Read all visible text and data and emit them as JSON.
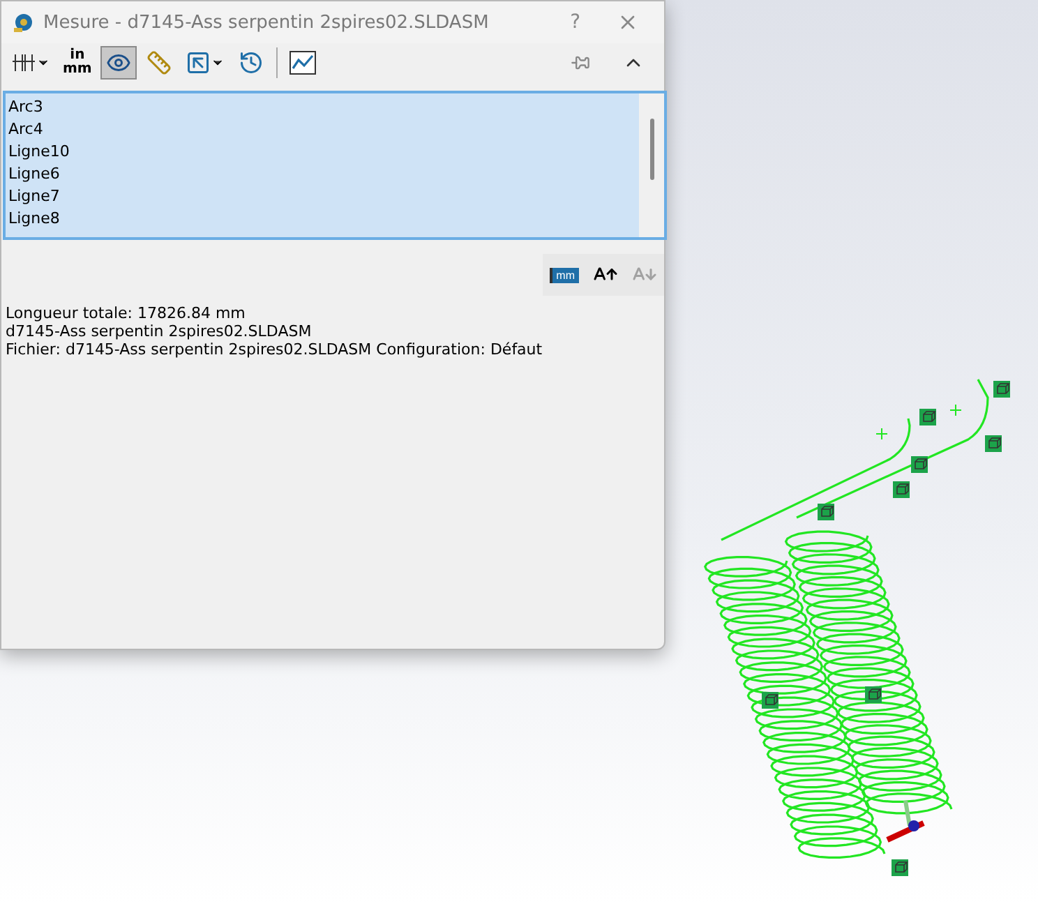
{
  "window": {
    "title": "Mesure - d7145-Ass serpentin 2spires02.SLDASM",
    "help": "?"
  },
  "toolbar": [
    {
      "kind": "dimensions",
      "pressed": false,
      "dropdown": true
    },
    {
      "kind": "units",
      "pressed": false,
      "dropdown": false,
      "top": "in",
      "bottom": "mm"
    },
    {
      "kind": "xyz",
      "pressed": true,
      "dropdown": false
    },
    {
      "kind": "point",
      "pressed": false,
      "dropdown": false
    },
    {
      "kind": "projection",
      "pressed": false,
      "dropdown": true
    },
    {
      "kind": "history",
      "pressed": false,
      "dropdown": false
    },
    {
      "kind": "sensor",
      "pressed": false,
      "dropdown": false
    }
  ],
  "selection": [
    {
      "label": "Arc3",
      "selected": true
    },
    {
      "label": "Arc4",
      "selected": true
    },
    {
      "label": "Ligne10",
      "selected": true
    },
    {
      "label": "Ligne6",
      "selected": true
    },
    {
      "label": "Ligne7",
      "selected": true
    },
    {
      "label": "Ligne8",
      "selected": true
    }
  ],
  "result_tools": [
    {
      "kind": "units",
      "label": "mm",
      "disabled": false
    },
    {
      "kind": "font_up",
      "disabled": false
    },
    {
      "kind": "font_down",
      "disabled": true
    }
  ],
  "results": [
    "Longueur totale: 17826.84 mm",
    "d7145-Ass serpentin 2spires02.SLDASM",
    "Fichier: d7145-Ass serpentin 2spires02.SLDASM Configuration: Défaut"
  ]
}
